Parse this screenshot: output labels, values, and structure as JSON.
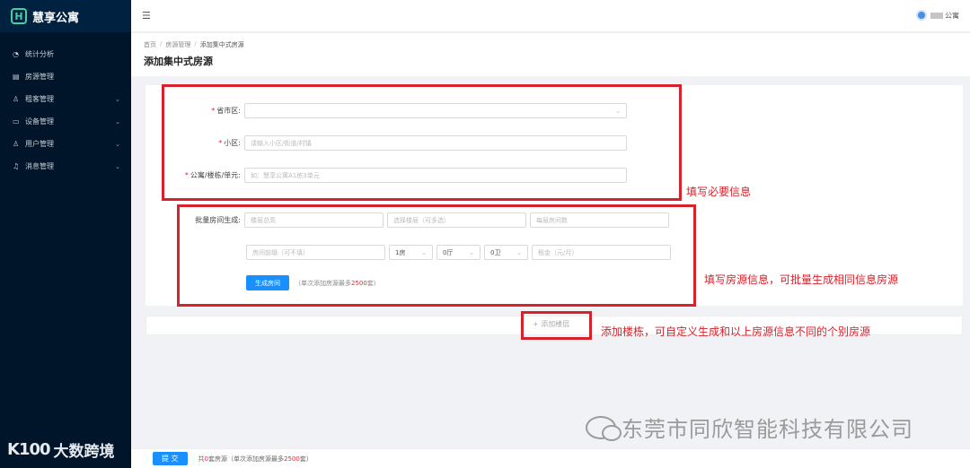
{
  "app": {
    "name": "慧享公寓",
    "logo_glyph": "H"
  },
  "sidebar": {
    "items": [
      {
        "label": "统计分析",
        "icon": "pie-chart-icon",
        "glyph": "◔",
        "expandable": false
      },
      {
        "label": "房源管理",
        "icon": "building-icon",
        "glyph": "▤",
        "expandable": false
      },
      {
        "label": "租客管理",
        "icon": "user-icon",
        "glyph": "♙",
        "expandable": true
      },
      {
        "label": "设备管理",
        "icon": "monitor-icon",
        "glyph": "▭",
        "expandable": true
      },
      {
        "label": "用户管理",
        "icon": "user-icon",
        "glyph": "♙",
        "expandable": true
      },
      {
        "label": "消息管理",
        "icon": "bell-icon",
        "glyph": "♫",
        "expandable": true
      }
    ]
  },
  "header": {
    "fold_glyph": "☰",
    "user_name": "公寓"
  },
  "breadcrumb": {
    "home": "首页",
    "section": "房源管理",
    "current": "添加集中式房源",
    "sep": "/"
  },
  "page_title": "添加集中式房源",
  "form": {
    "province_label": "省市区:",
    "community_label": "小区:",
    "community_placeholder": "请输入小区/街道/村镇",
    "building_label": "公寓/楼栋/单元:",
    "building_placeholder": "如：慧享公寓A1栋3单元",
    "batch_label": "批量房间生成:",
    "total_floors_placeholder": "楼层总高",
    "select_floors_placeholder": "选择楼层（可多选）",
    "rooms_per_floor_placeholder": "每层房间数",
    "room_prefix_placeholder": "房间前缀（可不填）",
    "bedroom_value": "1房",
    "livingroom_value": "0厅",
    "bathroom_value": "0卫",
    "rent_placeholder": "租金（元/月）",
    "generate_button": "生成房间",
    "generate_hint_pre": "（单次添加房源最多",
    "generate_hint_num": "2500",
    "generate_hint_post": "套）"
  },
  "add_floor": "+ 添加楼层",
  "annotations": {
    "required": "填写必要信息",
    "batch": "填写房源信息，可批量生成相同信息房源",
    "floor": "添加楼栋，可自定义生成和以上房源信息不同的个别房源"
  },
  "footer": {
    "submit": "提 交",
    "text_pre": "共",
    "count": "0",
    "text_mid": "套房源（单次添加房源最多",
    "max": "2500",
    "text_post": "套）"
  },
  "watermarks": {
    "left_logo": "K100",
    "left_text": "大数跨境",
    "right_text": "东莞市同欣智能科技有限公司"
  },
  "colors": {
    "primary": "#1890ff",
    "annotation": "#d6222a",
    "sidebar": "#001529",
    "required": "#f5222d"
  }
}
